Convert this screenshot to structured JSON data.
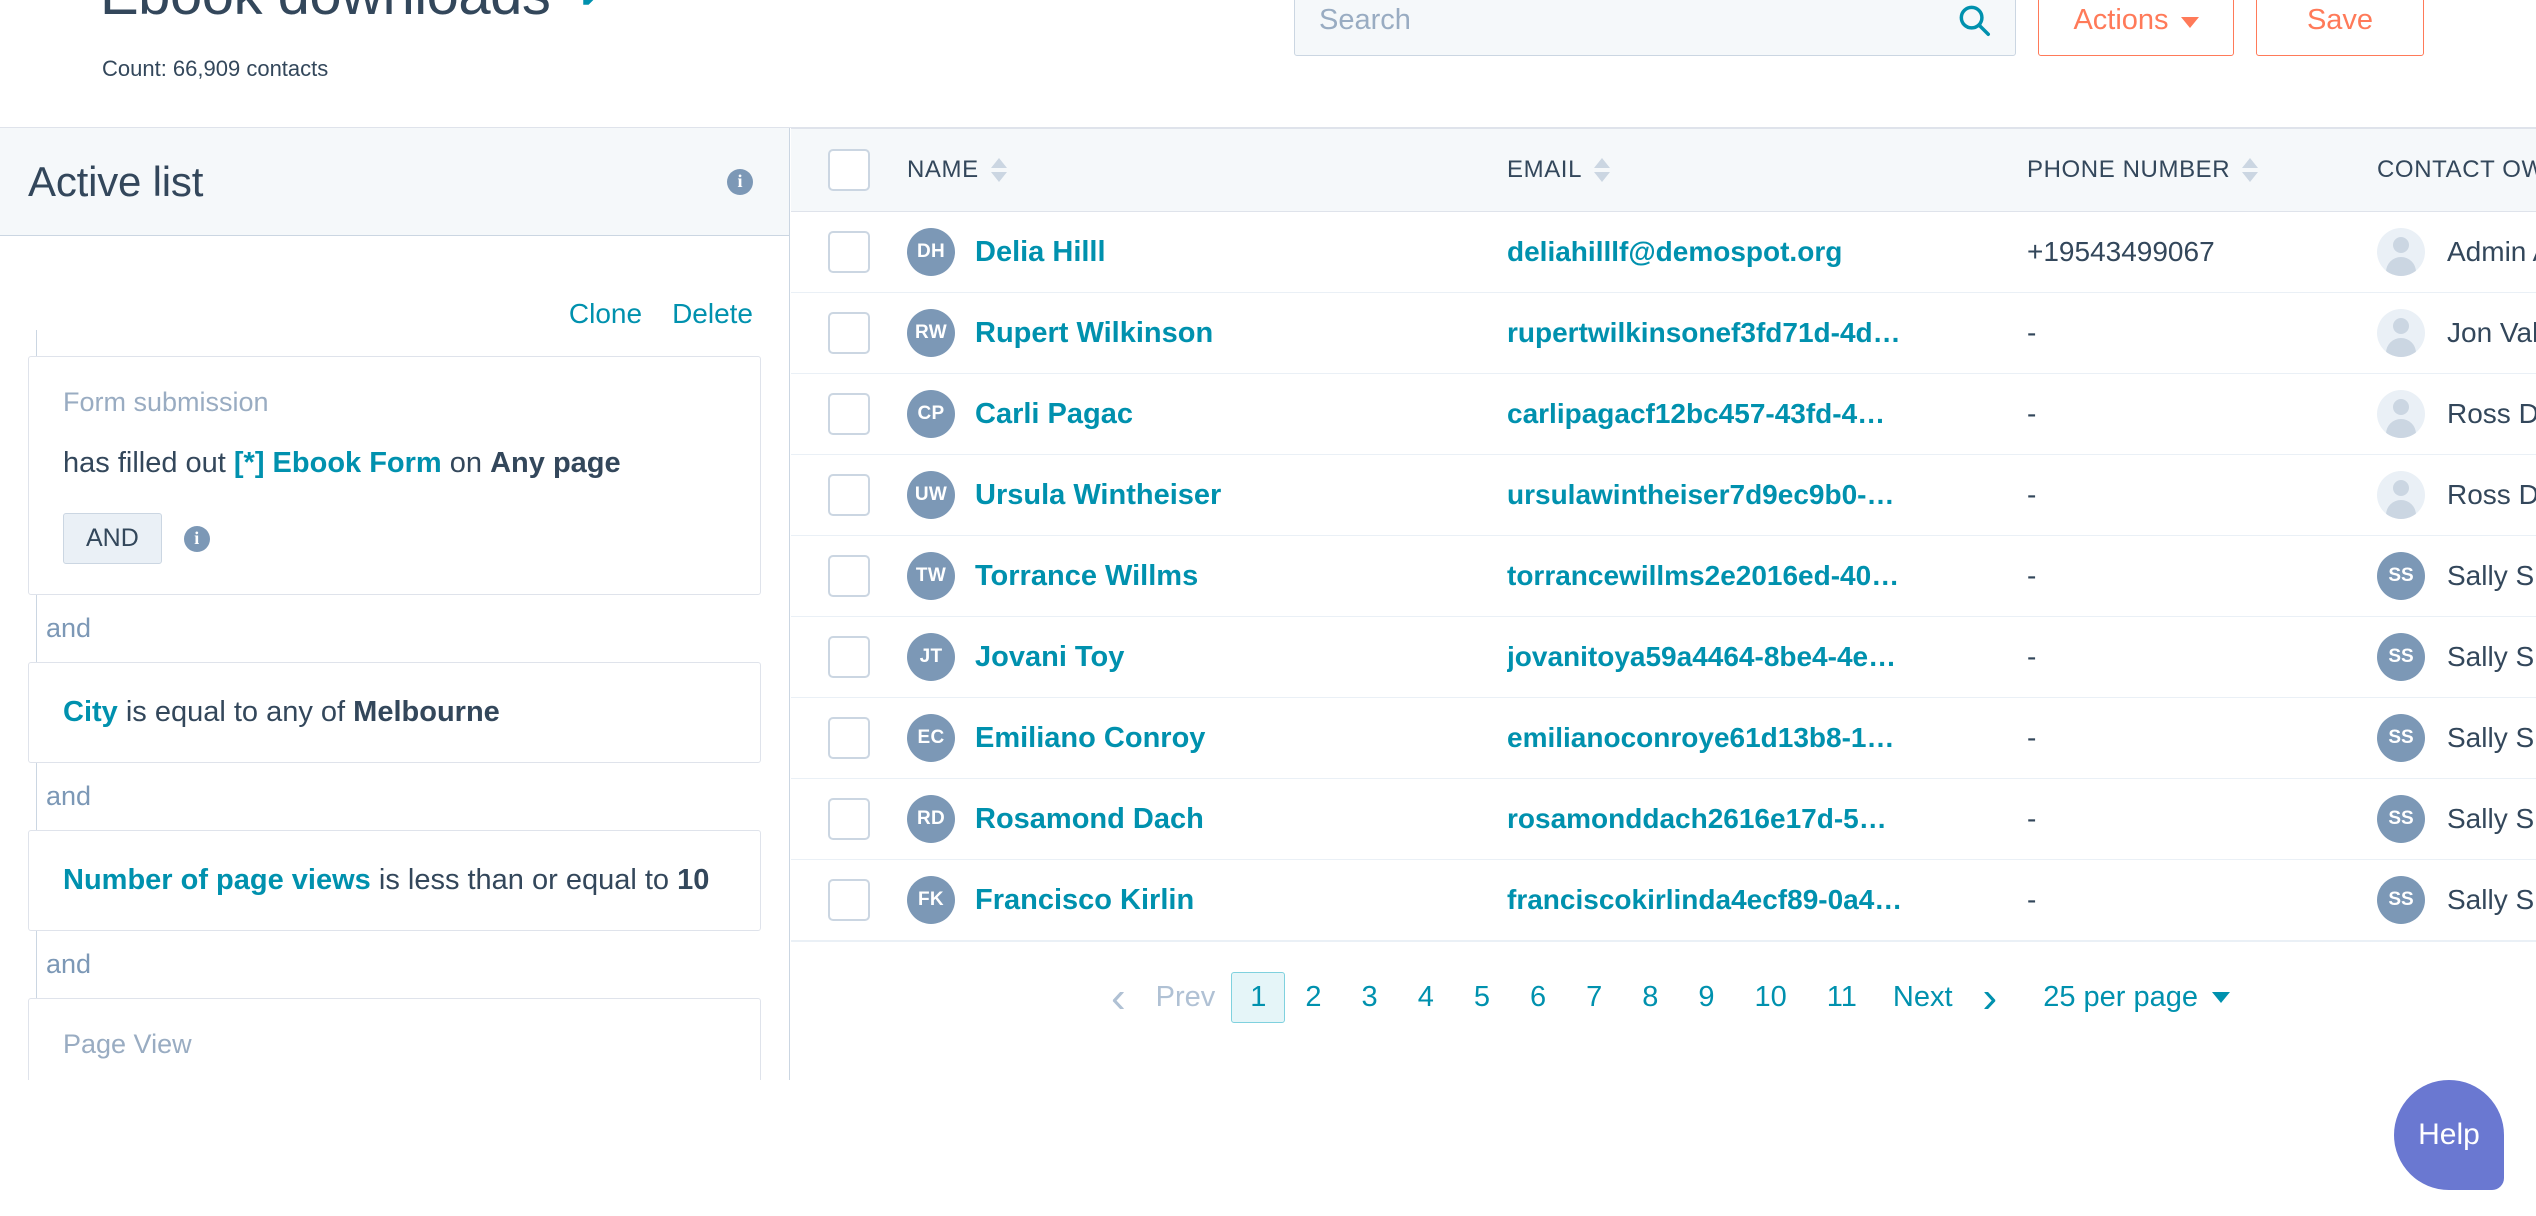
{
  "header": {
    "list_title": "Ebook downloads",
    "count_text": "Count: 66,909 contacts",
    "edit_icon": "pencil-icon",
    "search_placeholder": "Search",
    "search_value": "",
    "search_icon": "search-icon",
    "actions_label": "Actions",
    "save_label": "Save"
  },
  "left_panel": {
    "header_title": "Active list",
    "info_icon": "info-icon",
    "clone_label": "Clone",
    "delete_label": "Delete",
    "connector_label": "and",
    "filters": [
      {
        "label": "Form submission",
        "prefix": "has filled out ",
        "link": "[*] Ebook Form",
        "middle": " on ",
        "strong": "Any page",
        "and_chip": "AND",
        "info_icon": "info-icon"
      },
      {
        "label": "",
        "link": "City",
        "middle": " is equal to any of ",
        "strong": "Melbourne"
      },
      {
        "label": "",
        "link": "Number of page views",
        "middle": " is less than or equal to ",
        "strong": "10"
      },
      {
        "label": "Page View",
        "link": "",
        "middle": "",
        "strong": ""
      }
    ]
  },
  "table": {
    "columns": [
      {
        "key": "name",
        "label": "NAME",
        "sortable": true
      },
      {
        "key": "email",
        "label": "EMAIL",
        "sortable": true
      },
      {
        "key": "phone",
        "label": "PHONE NUMBER",
        "sortable": true
      },
      {
        "key": "owner",
        "label": "CONTACT OW",
        "sortable": false
      }
    ],
    "rows": [
      {
        "initials": "DH",
        "name": "Delia Hilll",
        "email": "deliahilllf@demospot.org",
        "phone": "+19543499067",
        "owner": "Admin A",
        "owner_initials": ""
      },
      {
        "initials": "RW",
        "name": "Rupert Wilkinson",
        "email": "rupertwilkinsonef3fd71d-4d…",
        "phone": "-",
        "owner": "Jon Vale",
        "owner_initials": ""
      },
      {
        "initials": "CP",
        "name": "Carli Pagac",
        "email": "carlipagacf12bc457-43fd-4…",
        "phone": "-",
        "owner": "Ross Du",
        "owner_initials": ""
      },
      {
        "initials": "UW",
        "name": "Ursula Wintheiser",
        "email": "ursulawintheiser7d9ec9b0-…",
        "phone": "-",
        "owner": "Ross Du",
        "owner_initials": ""
      },
      {
        "initials": "TW",
        "name": "Torrance Willms",
        "email": "torrancewillms2e2016ed-40…",
        "phone": "-",
        "owner": "Sally Sm",
        "owner_initials": "SS"
      },
      {
        "initials": "JT",
        "name": "Jovani Toy",
        "email": "jovanitoya59a4464-8be4-4e…",
        "phone": "-",
        "owner": "Sally Sm",
        "owner_initials": "SS"
      },
      {
        "initials": "EC",
        "name": "Emiliano Conroy",
        "email": "emilianoconroye61d13b8-1…",
        "phone": "-",
        "owner": "Sally Sm",
        "owner_initials": "SS"
      },
      {
        "initials": "RD",
        "name": "Rosamond Dach",
        "email": "rosamonddach2616e17d-5…",
        "phone": "-",
        "owner": "Sally Sm",
        "owner_initials": "SS"
      },
      {
        "initials": "FK",
        "name": "Francisco Kirlin",
        "email": "franciscokirlinda4ecf89-0a4…",
        "phone": "-",
        "owner": "Sally Sm",
        "owner_initials": "SS"
      }
    ]
  },
  "pagination": {
    "prev_label": "Prev",
    "next_label": "Next",
    "pages": [
      "1",
      "2",
      "3",
      "4",
      "5",
      "6",
      "7",
      "8",
      "9",
      "10",
      "11"
    ],
    "active_page": "1",
    "per_page_label": "25 per page"
  },
  "help": {
    "label": "Help"
  },
  "colors": {
    "accent_teal": "#0091ae",
    "accent_orange": "#ff7a59",
    "text_dark": "#33475b",
    "muted": "#99acc2",
    "panel_bg": "#f5f8fa",
    "border": "#cbd6e2",
    "help_purple": "#6a78d1",
    "avatar_blue": "#7c98b6"
  }
}
